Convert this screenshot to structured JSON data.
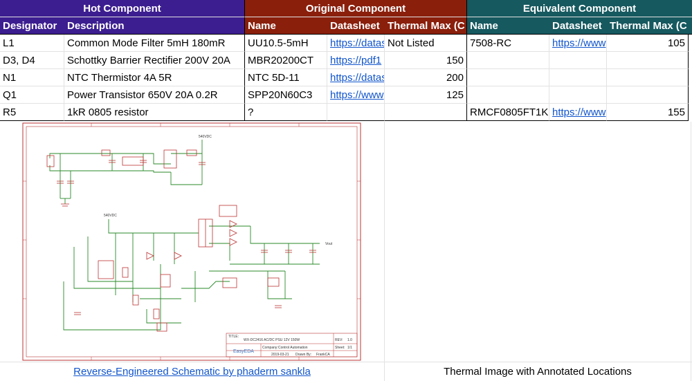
{
  "groups": {
    "hot": "Hot Component",
    "original": "Original Component",
    "equivalent": "Equivalent Component"
  },
  "headers": {
    "designator": "Designator",
    "description": "Description",
    "name": "Name",
    "datasheet": "Datasheet",
    "thermal_max": "Thermal Max (C",
    "name2": "Name",
    "datasheet2": "Datasheet",
    "thermal_max2": "Thermal Max (C"
  },
  "rows": [
    {
      "designator": "L1",
      "description": "Common Mode Filter 5mH 180mR",
      "orig_name": "UU10.5-5mH",
      "orig_datasheet": "https://datas",
      "orig_thermal": "Not Listed",
      "eq_name": "7508-RC",
      "eq_datasheet": "https://www",
      "eq_thermal": "105"
    },
    {
      "designator": "D3, D4",
      "description": "Schottky Barrier Rectifier 200V 20A",
      "orig_name": "MBR20200CT",
      "orig_datasheet": "https://pdf1",
      "orig_thermal": "150",
      "eq_name": "",
      "eq_datasheet": "",
      "eq_thermal": ""
    },
    {
      "designator": "N1",
      "description": "NTC Thermistor 4A 5R",
      "orig_name": "NTC 5D-11",
      "orig_datasheet": "https://datas",
      "orig_thermal": "200",
      "eq_name": "",
      "eq_datasheet": "",
      "eq_thermal": ""
    },
    {
      "designator": "Q1",
      "description": "Power Transistor 650V 20A 0.2R",
      "orig_name": "SPP20N60C3",
      "orig_datasheet": "https://www",
      "orig_thermal": "125",
      "eq_name": "",
      "eq_datasheet": "",
      "eq_thermal": ""
    },
    {
      "designator": "R5",
      "description": "1kR 0805 resistor",
      "orig_name": "?",
      "orig_datasheet": "",
      "orig_thermal": "",
      "eq_name": "RMCF0805FT1K",
      "eq_datasheet": "https://www",
      "eq_thermal": "155"
    }
  ],
  "schematic": {
    "title_label": "TITLE:",
    "title": "WX-DC2416 AC/DC PSU 12V 150W",
    "rev_label": "REV:",
    "rev": "1.0",
    "company_label": "Company:",
    "company": "Control Automation",
    "sheet_label": "Sheet:",
    "sheet": "1/1",
    "date": "2019-03-21",
    "drawn_label": "Drawn By:",
    "drawn": "FrankCA",
    "brand": "EasyEDA",
    "v540_a": "540VDC",
    "v540_b": "540VDC",
    "vout": "Vout"
  },
  "footer": {
    "link": "Reverse-Engineered Schematic by phaderm sankla",
    "caption": "Thermal Image with Annotated Locations"
  }
}
